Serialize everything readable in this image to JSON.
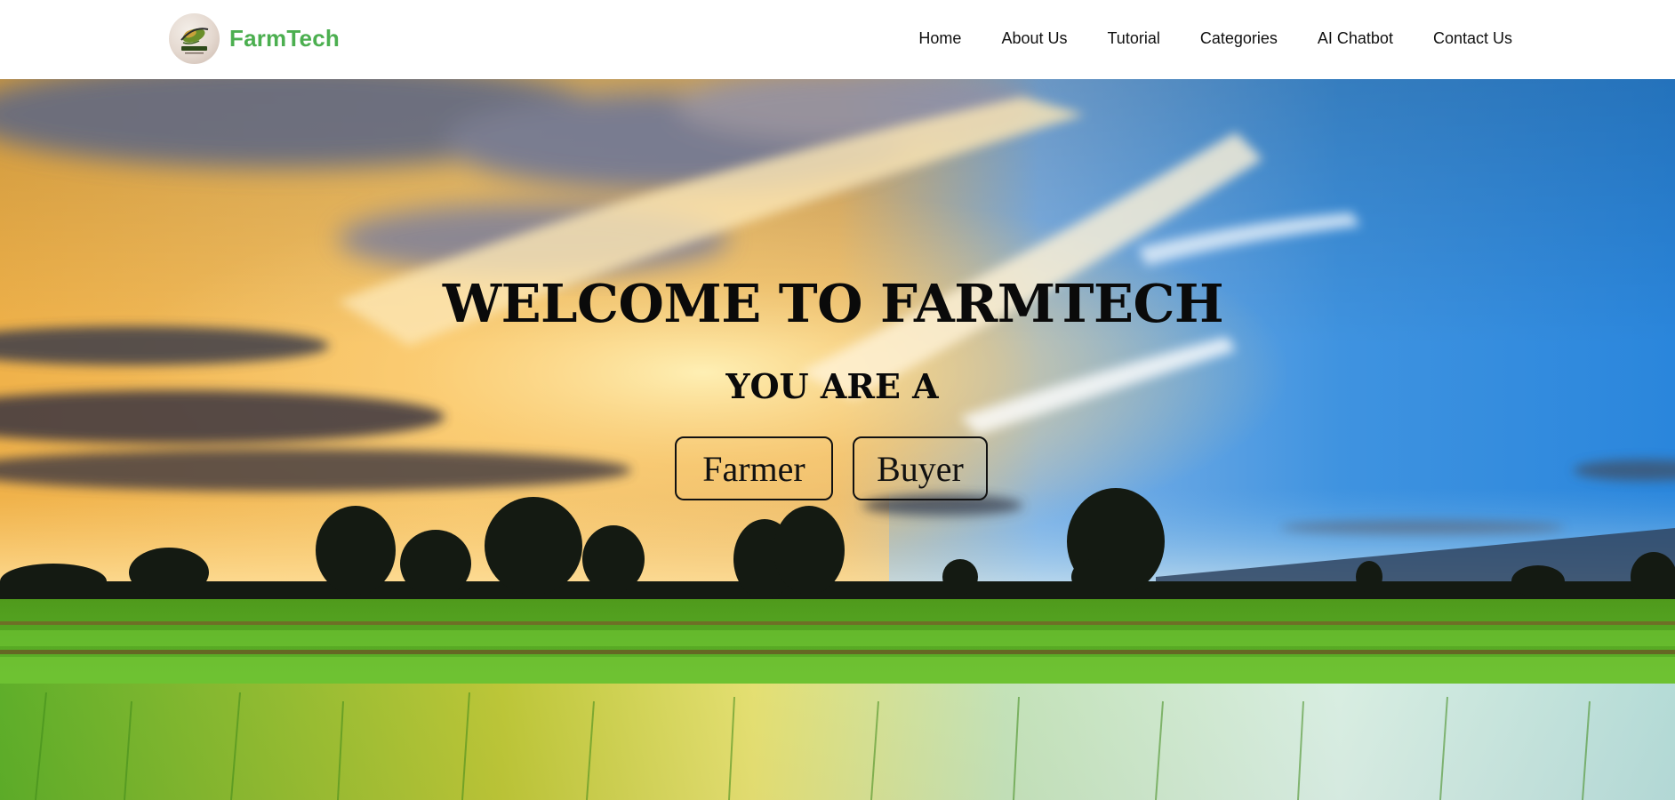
{
  "brand": {
    "name": "FarmTech",
    "logo_text": "FarmTech",
    "color": "#4caf50"
  },
  "nav": {
    "items": [
      {
        "label": "Home"
      },
      {
        "label": "About Us"
      },
      {
        "label": "Tutorial"
      },
      {
        "label": "Categories"
      },
      {
        "label": "AI Chatbot"
      },
      {
        "label": "Contact Us"
      }
    ]
  },
  "hero": {
    "background": "sunset-over-rice-field-photo",
    "title": "WELCOME TO FARMTECH",
    "subtitle": "YOU ARE A",
    "buttons": {
      "farmer": "Farmer",
      "buyer": "Buyer"
    }
  }
}
